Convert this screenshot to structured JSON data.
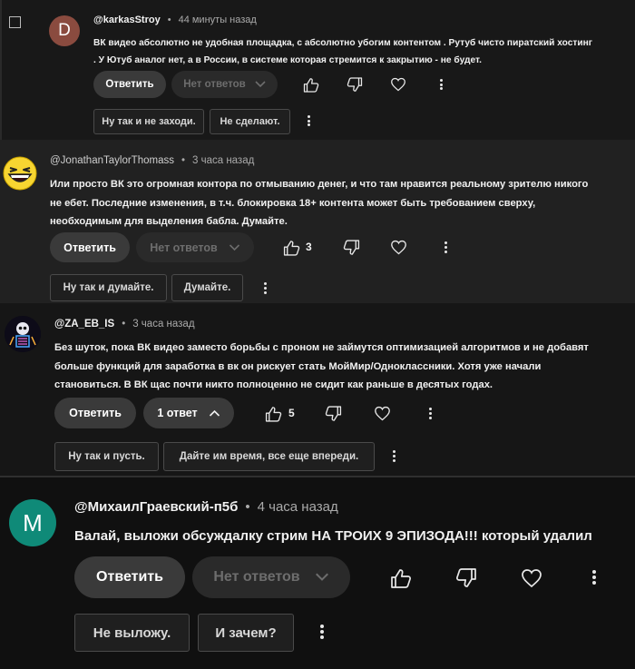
{
  "comments": [
    {
      "avatar_letter": "D",
      "avatar_color": "#8a4b3f",
      "handle": "@karkasStroy",
      "time": "44 минуты назад",
      "text_line1": "ВК видео абсолютно не удобная площадка, с абсолютно убогим контентом . Рутуб чисто пиратский хостинг",
      "text_line2": ". У Ютуб аналог нет, а в России, в системе которая стремится к закрытию - не будет.",
      "reply_label": "Ответить",
      "replies_label": "Нет ответов",
      "like_count": "",
      "suggestions": [
        "Ну так и не заходи.",
        "Не сделают."
      ]
    },
    {
      "avatar_icon": "laughing-face-icon",
      "handle": "@JonathanTaylorThomass",
      "time": "3 часа назад",
      "text_line1": "Или просто ВК это огромная контора по отмыванию денег, и что там нравится реальному зрителю никого",
      "text_line2": "не ебет. Последние изменения, в т.ч. блокировка 18+ контента может быть требованием сверху,",
      "text_line3": "необходимым для выделения бабла. Думайте.",
      "reply_label": "Ответить",
      "replies_label": "Нет ответов",
      "like_count": "3",
      "suggestions": [
        "Ну так и думайте.",
        "Думайте."
      ]
    },
    {
      "avatar_icon": "skeleton-avatar-icon",
      "handle": "@ZA_EB_IS",
      "time": "3 часа назад",
      "text_line1": "Без шуток, пока ВК видео заместо борьбы с проном не займутся оптимизацией алгоритмов и не добавят",
      "text_line2": "больше функций для заработка в вк он рискует стать МойМир/Одноклассники. Хотя уже начали",
      "text_line3": "становиться. В ВК щас почти никто полноценно не сидит как раньше в десятых годах.",
      "reply_label": "Ответить",
      "replies_label": "1 ответ",
      "like_count": "5",
      "suggestions": [
        "Ну так и пусть.",
        "Дайте им время, все еще впереди."
      ]
    },
    {
      "avatar_letter": "M",
      "avatar_color": "#0f8a78",
      "handle": "@МихаилГраевский-п5б",
      "time": "4 часа назад",
      "text_line1": "Валай, выложи обсуждалку стрим НА ТРОИХ 9 ЭПИЗОДА!!! который удалил",
      "reply_label": "Ответить",
      "replies_label": "Нет ответов",
      "like_count": "",
      "suggestions": [
        "Не выложу.",
        "И зачем?"
      ]
    }
  ],
  "separator": "•"
}
